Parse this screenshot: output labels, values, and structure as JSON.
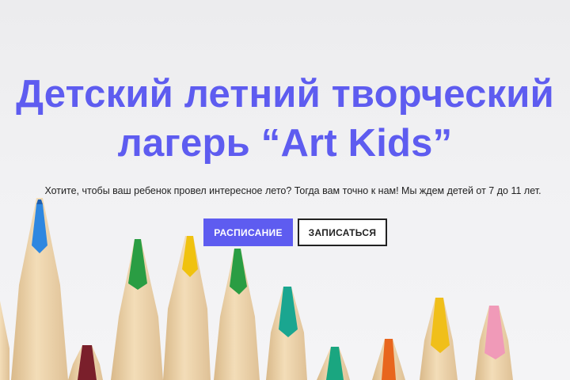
{
  "hero": {
    "title_line1": "Детский летний творческий",
    "title_line2": "лагерь “Art Kids”",
    "subtitle": "Хотите, чтобы ваш ребенок провел интересное лето? Тогда вам точно к нам! Мы ждем детей от 7 до 11 лет.",
    "primary_button": "РАСПИСАНИЕ",
    "secondary_button": "ЗАПИСАТЬСЯ"
  },
  "colors": {
    "accent": "#5e5cf0",
    "pencil_wood": "#f0d7b0",
    "pencil_shadow": "#dcbc8c",
    "pencil_leads": [
      "#2e87e0",
      "#2a9d43",
      "#f0c20f",
      "#2a9d43",
      "#1aa690",
      "#7a1f2b",
      "#1aa680",
      "#e8661e",
      "#f0bf1a",
      "#f09ab8"
    ]
  },
  "background_image": {
    "icon": "colored-pencils-image"
  }
}
